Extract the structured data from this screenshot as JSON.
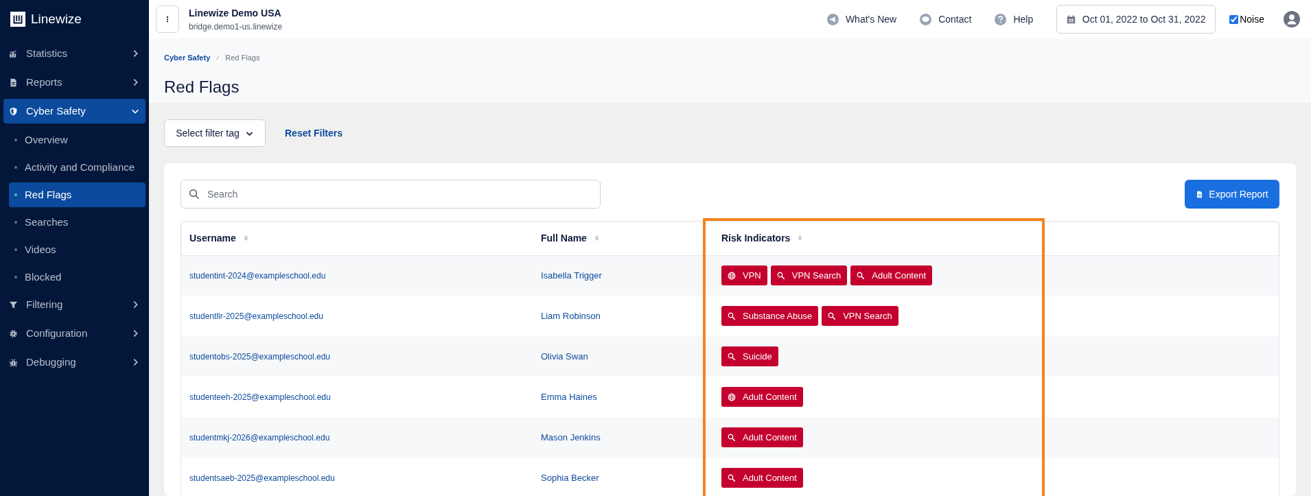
{
  "sidebar": {
    "brand": "Linewize",
    "items": [
      {
        "label": "Statistics",
        "expanded": false,
        "selected": false
      },
      {
        "label": "Reports",
        "expanded": false,
        "selected": false
      },
      {
        "label": "Cyber Safety",
        "expanded": true,
        "selected": true,
        "children": [
          {
            "label": "Overview",
            "selected": false
          },
          {
            "label": "Activity and Compliance",
            "selected": false
          },
          {
            "label": "Red Flags",
            "selected": true
          },
          {
            "label": "Searches",
            "selected": false
          },
          {
            "label": "Videos",
            "selected": false
          },
          {
            "label": "Blocked",
            "selected": false
          }
        ]
      },
      {
        "label": "Filtering",
        "expanded": false,
        "selected": false
      },
      {
        "label": "Configuration",
        "expanded": false,
        "selected": false
      },
      {
        "label": "Debugging",
        "expanded": false,
        "selected": false
      }
    ]
  },
  "header": {
    "org": "Linewize Demo USA",
    "host": "bridge.demo1-us.linewize",
    "links": [
      {
        "label": "What's New"
      },
      {
        "label": "Contact"
      },
      {
        "label": "Help"
      }
    ],
    "date_range": "Oct 01, 2022 to Oct 31, 2022",
    "noise": {
      "label": "Noise",
      "checked": true
    }
  },
  "breadcrumb": [
    "Cyber Safety",
    "Red Flags"
  ],
  "title": "Red Flags",
  "filter": {
    "select": "Select filter tag",
    "reset": "Reset Filters"
  },
  "search": {
    "placeholder": "Search"
  },
  "export": "Export Report",
  "table": {
    "columns": [
      "Username",
      "Full Name",
      "Risk Indicators"
    ],
    "rows": [
      {
        "username": "studentint-2024@exampleschool.edu",
        "name": "Isabella Trigger",
        "tags": [
          {
            "kind": "web",
            "label": "VPN"
          },
          {
            "kind": "search",
            "label": "VPN Search"
          },
          {
            "kind": "search",
            "label": "Adult Content"
          }
        ]
      },
      {
        "username": "studentllr-2025@exampleschool.edu",
        "name": "Liam Robinson",
        "tags": [
          {
            "kind": "search",
            "label": "Substance Abuse"
          },
          {
            "kind": "search",
            "label": "VPN Search"
          }
        ]
      },
      {
        "username": "studentobs-2025@exampleschool.edu",
        "name": "Olivia Swan",
        "tags": [
          {
            "kind": "search",
            "label": "Suicide"
          }
        ]
      },
      {
        "username": "studenteeh-2025@exampleschool.edu",
        "name": "Emma Haines",
        "tags": [
          {
            "kind": "web",
            "label": "Adult Content"
          }
        ]
      },
      {
        "username": "studentmkj-2026@exampleschool.edu",
        "name": "Mason Jenkins",
        "tags": [
          {
            "kind": "search",
            "label": "Adult Content"
          }
        ]
      },
      {
        "username": "studentsaeb-2025@exampleschool.edu",
        "name": "Sophia Becker",
        "tags": [
          {
            "kind": "search",
            "label": "Adult Content"
          }
        ]
      }
    ]
  }
}
